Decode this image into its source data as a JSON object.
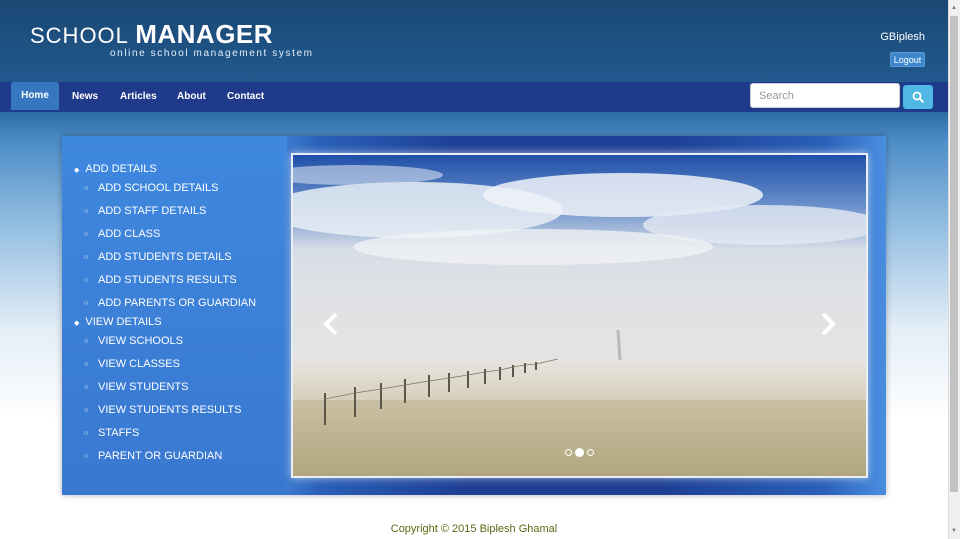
{
  "header": {
    "logo_part1": "SCHOOL",
    "logo_part2": "MANAGER",
    "tagline": "online school management system",
    "user": "GBiplesh",
    "logout_label": "Logout"
  },
  "nav": {
    "items": [
      {
        "label": "Home",
        "active": true
      },
      {
        "label": "News",
        "active": false
      },
      {
        "label": "Articles",
        "active": false
      },
      {
        "label": "About",
        "active": false
      },
      {
        "label": "Contact",
        "active": false
      }
    ],
    "search_placeholder": "Search",
    "search_icon": "search-icon"
  },
  "sidebar": {
    "sections": [
      {
        "title": "ADD DETAILS",
        "items": [
          "ADD SCHOOL DETAILS",
          "ADD STAFF DETAILS",
          "ADD CLASS",
          "ADD STUDENTS DETAILS",
          "ADD STUDENTS RESULTS",
          "ADD PARENTS OR GUARDIAN"
        ]
      },
      {
        "title": "VIEW DETAILS",
        "items": [
          "VIEW SCHOOLS",
          "VIEW CLASSES",
          "VIEW STUDENTS",
          "VIEW STUDENTS RESULTS",
          "STAFFS",
          "PARENT OR GUARDIAN"
        ]
      }
    ]
  },
  "carousel": {
    "prev_icon": "chevron-left-icon",
    "next_icon": "chevron-right-icon",
    "slide_count": 3,
    "active_slide": 2
  },
  "footer": {
    "copyright": "Copyright © 2015 Biplesh Ghamal"
  },
  "colors": {
    "header_bg": "#1a4874",
    "nav_bg": "#1f3a8a",
    "nav_active": "#3777c0",
    "search_button": "#4fb8e4",
    "panel_left": "#3f88df",
    "footer_text": "#5a6a14"
  }
}
